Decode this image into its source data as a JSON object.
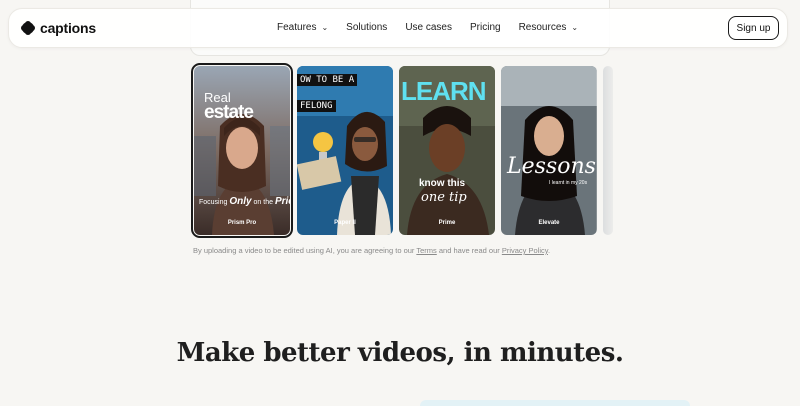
{
  "header": {
    "brand": "captions",
    "nav": [
      {
        "label": "Features",
        "has_menu": true
      },
      {
        "label": "Solutions",
        "has_menu": false
      },
      {
        "label": "Use cases",
        "has_menu": false
      },
      {
        "label": "Pricing",
        "has_menu": false
      },
      {
        "label": "Resources",
        "has_menu": true
      }
    ],
    "signup_label": "Sign up"
  },
  "templates": [
    {
      "name": "Prism Pro",
      "overlay_top": "Real",
      "overlay_main": "estate",
      "overlay_bottom_pre": "Focusing ",
      "overlay_bottom_em": "Only",
      "overlay_bottom_mid": " on the ",
      "overlay_bottom_end": "Price",
      "selected": true
    },
    {
      "name": "Paper II",
      "overlay_line1": "OW TO BE A",
      "overlay_line2": "FELONG",
      "selected": false
    },
    {
      "name": "Prime",
      "overlay_top": "LEARN",
      "overlay_line1": "know this",
      "overlay_line2": "one tip",
      "selected": false
    },
    {
      "name": "Elevate",
      "overlay_main": "Lessons",
      "overlay_small": "I learnt in my 20s",
      "selected": false
    }
  ],
  "disclaimer": {
    "prefix": "By uploading a video to be edited using AI, you are agreeing to our ",
    "terms": "Terms",
    "middle": " and have read our ",
    "privacy": "Privacy Policy",
    "suffix": "."
  },
  "headline": "Make better videos, in minutes.",
  "colors": {
    "background": "#f7f6f3",
    "text": "#1a1a1a",
    "accent_hint": "#e3f2f6"
  }
}
